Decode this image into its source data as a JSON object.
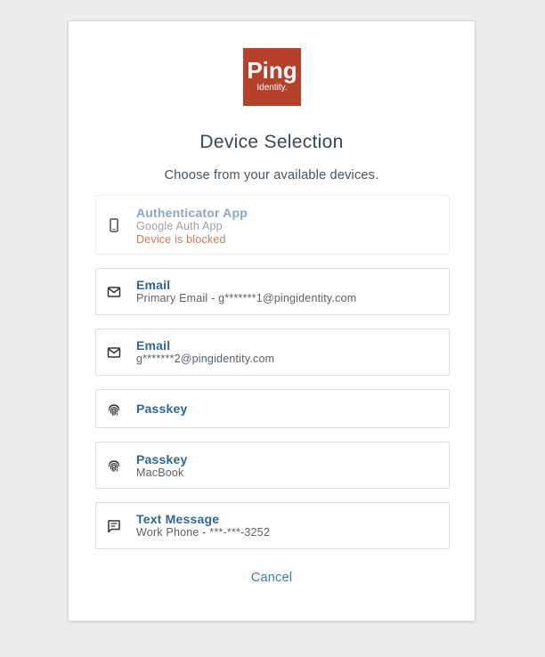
{
  "brand": {
    "logo_text": "Ping",
    "logo_subtext": "Identity.",
    "color": "#b5412a"
  },
  "page": {
    "title": "Device Selection",
    "subtitle": "Choose from your available devices.",
    "cancel_label": "Cancel"
  },
  "devices": [
    {
      "icon": "phone-icon",
      "name": "Authenticator App",
      "detail": "Google Auth App",
      "status": "Device is blocked",
      "disabled": true
    },
    {
      "icon": "mail-icon",
      "name": "Email",
      "detail": "Primary Email - g*******1@pingidentity.com"
    },
    {
      "icon": "mail-icon",
      "name": "Email",
      "detail": "g*******2@pingidentity.com"
    },
    {
      "icon": "fingerprint-icon",
      "name": "Passkey",
      "detail": ""
    },
    {
      "icon": "fingerprint-icon",
      "name": "Passkey",
      "detail": "MacBook"
    },
    {
      "icon": "message-icon",
      "name": "Text Message",
      "detail": "Work Phone - ***-***-3252"
    }
  ],
  "colors": {
    "link": "#2f6694",
    "blocked": "#cf7a5a",
    "background": "#ededed"
  }
}
